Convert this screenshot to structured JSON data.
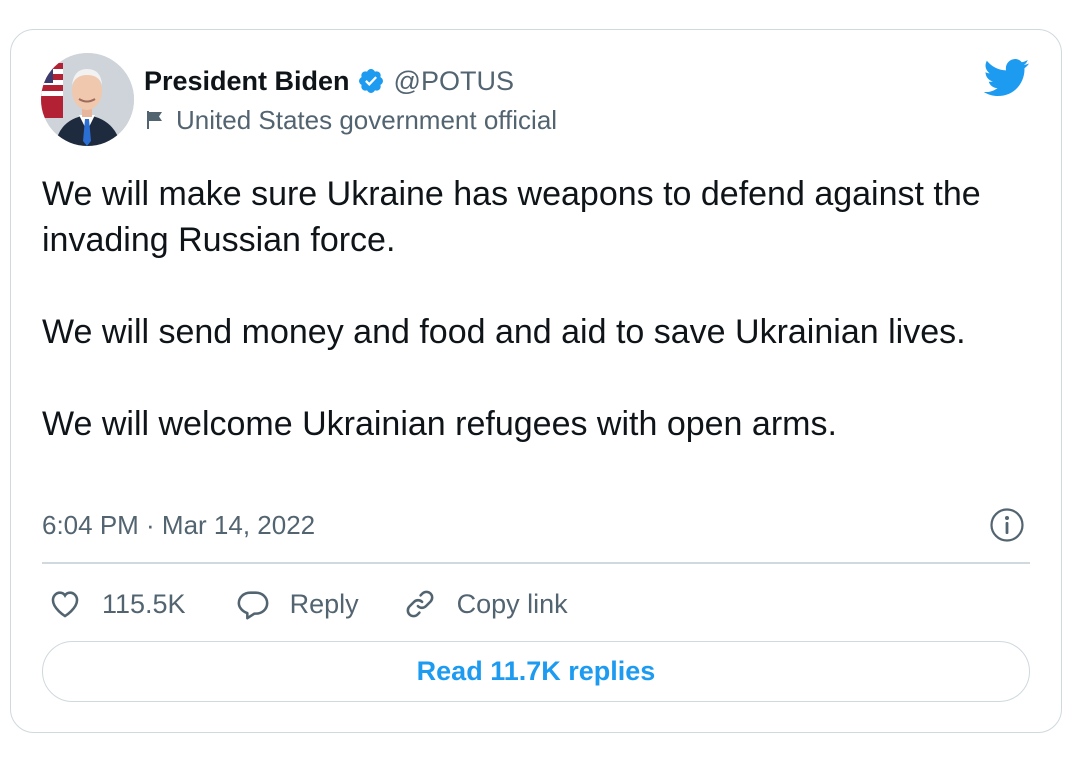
{
  "tweet": {
    "author": {
      "name": "President Biden",
      "handle": "@POTUS",
      "label": "United States government official"
    },
    "paragraphs": [
      "We will make sure Ukraine has weapons to defend against the invading Russian force.",
      "We will send money and food and aid to save Ukrainian lives.",
      "We will welcome Ukrainian refugees with open arms."
    ],
    "timestamp": "6:04 PM · Mar 14, 2022",
    "actions": {
      "likes": "115.5K",
      "reply_label": "Reply",
      "copy_label": "Copy link"
    },
    "read_replies_label": "Read 11.7K replies"
  },
  "colors": {
    "accent": "#1d9bf0",
    "text": "#0f1419",
    "secondary": "#536471",
    "border": "#cfd9de"
  },
  "icons": [
    "avatar",
    "verified-badge-icon",
    "flag-icon",
    "twitter-bird-icon",
    "info-icon",
    "heart-icon",
    "reply-bubble-icon",
    "link-icon"
  ]
}
